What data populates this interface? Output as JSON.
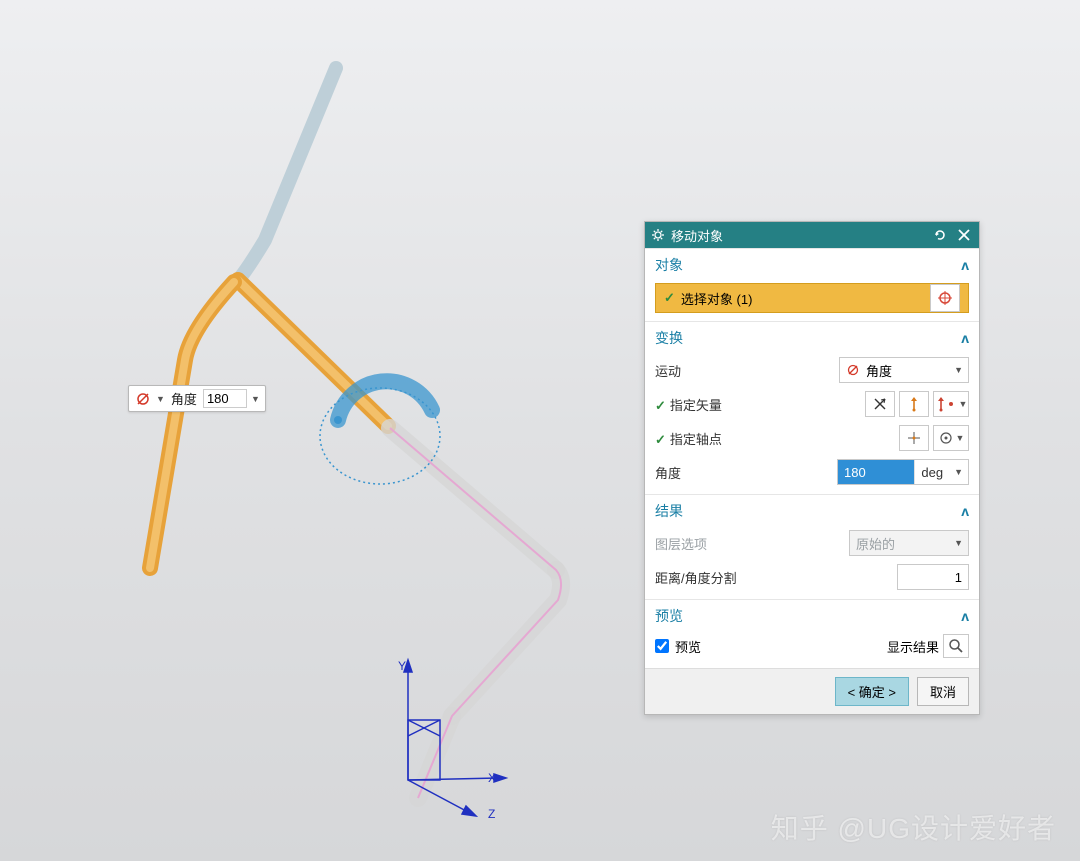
{
  "mini_toolbar": {
    "angle_label": "角度",
    "angle_value": "180"
  },
  "dialog": {
    "title": "移动对象",
    "sections": {
      "object": {
        "header": "对象",
        "select_label": "选择对象 (1)"
      },
      "transform": {
        "header": "变换",
        "motion_label": "运动",
        "motion_value": "角度",
        "vector_label": "指定矢量",
        "axis_point_label": "指定轴点",
        "angle_label": "角度",
        "angle_value": "180",
        "angle_unit": "deg"
      },
      "result": {
        "header": "结果",
        "layer_option_label": "图层选项",
        "layer_option_value": "原始的",
        "distance_angle_split_label": "距离/角度分割",
        "distance_angle_split_value": "1"
      },
      "preview": {
        "header": "预览",
        "checkbox_label": "预览",
        "show_result_label": "显示结果"
      }
    },
    "footer": {
      "ok": "< 确定 >",
      "cancel": "取消"
    }
  },
  "axes": {
    "x": "X",
    "y": "Y",
    "z": "Z"
  },
  "watermark": "知乎 @UG设计爱好者"
}
